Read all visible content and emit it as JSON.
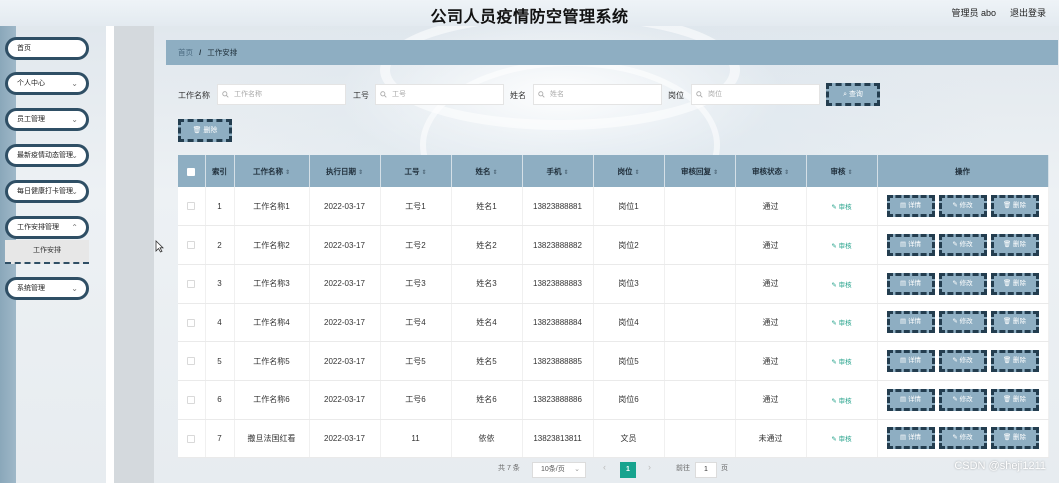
{
  "header": {
    "title": "公司人员疫情防空管理系统",
    "user": "管理员 abo",
    "logout": "退出登录"
  },
  "sidebar": {
    "items": [
      {
        "label": "首页",
        "chevron": false
      },
      {
        "label": "个人中心",
        "chevron": true
      },
      {
        "label": "员工管理",
        "chevron": true
      },
      {
        "label": "最新疫情动态管理",
        "chevron": true
      },
      {
        "label": "每日健康打卡管理",
        "chevron": true
      },
      {
        "label": "工作安排管理",
        "chevron": true
      },
      {
        "label": "系统管理",
        "chevron": true
      }
    ],
    "submenu": "工作安排"
  },
  "breadcrumb": {
    "home": "首页",
    "sep": "/",
    "current": "工作安排"
  },
  "search": {
    "work_name_label": "工作名称",
    "work_name_placeholder": "工作名称",
    "job_no_label": "工号",
    "job_no_placeholder": "工号",
    "name_label": "姓名",
    "name_placeholder": "姓名",
    "post_label": "岗位",
    "post_placeholder": "岗位",
    "query_button": "查询",
    "delete_button": "删除"
  },
  "table": {
    "headers": [
      "索引",
      "工作名称",
      "执行日期",
      "工号",
      "姓名",
      "手机",
      "岗位",
      "审核回复",
      "审核状态",
      "审核",
      "操作"
    ],
    "audit_label": "审核",
    "op_detail": "详情",
    "op_edit": "修改",
    "op_delete": "删除",
    "rows": [
      {
        "idx": "1",
        "work": "工作名称1",
        "date": "2022-03-17",
        "no": "工号1",
        "name": "姓名1",
        "phone": "13823888881",
        "post": "岗位1",
        "reply": "",
        "status": "通过"
      },
      {
        "idx": "2",
        "work": "工作名称2",
        "date": "2022-03-17",
        "no": "工号2",
        "name": "姓名2",
        "phone": "13823888882",
        "post": "岗位2",
        "reply": "",
        "status": "通过"
      },
      {
        "idx": "3",
        "work": "工作名称3",
        "date": "2022-03-17",
        "no": "工号3",
        "name": "姓名3",
        "phone": "13823888883",
        "post": "岗位3",
        "reply": "",
        "status": "通过"
      },
      {
        "idx": "4",
        "work": "工作名称4",
        "date": "2022-03-17",
        "no": "工号4",
        "name": "姓名4",
        "phone": "13823888884",
        "post": "岗位4",
        "reply": "",
        "status": "通过"
      },
      {
        "idx": "5",
        "work": "工作名称5",
        "date": "2022-03-17",
        "no": "工号5",
        "name": "姓名5",
        "phone": "13823888885",
        "post": "岗位5",
        "reply": "",
        "status": "通过"
      },
      {
        "idx": "6",
        "work": "工作名称6",
        "date": "2022-03-17",
        "no": "工号6",
        "name": "姓名6",
        "phone": "13823888886",
        "post": "岗位6",
        "reply": "",
        "status": "通过"
      },
      {
        "idx": "7",
        "work": "撒旦法国红看",
        "date": "2022-03-17",
        "no": "11",
        "name": "依依",
        "phone": "13823813811",
        "post": "文员",
        "reply": "",
        "status": "未通过"
      }
    ]
  },
  "pagination": {
    "total": "共 7 条",
    "page_size": "10条/页",
    "prev": "‹",
    "current": "1",
    "next": "›",
    "goto_label": "前往",
    "goto_value": "1",
    "page_unit": "页"
  },
  "watermark": "CSDN @sheji1211",
  "colors": {
    "accent": "#8eaec2",
    "border_dark": "#233d4f",
    "pager_active": "#17a38e"
  }
}
